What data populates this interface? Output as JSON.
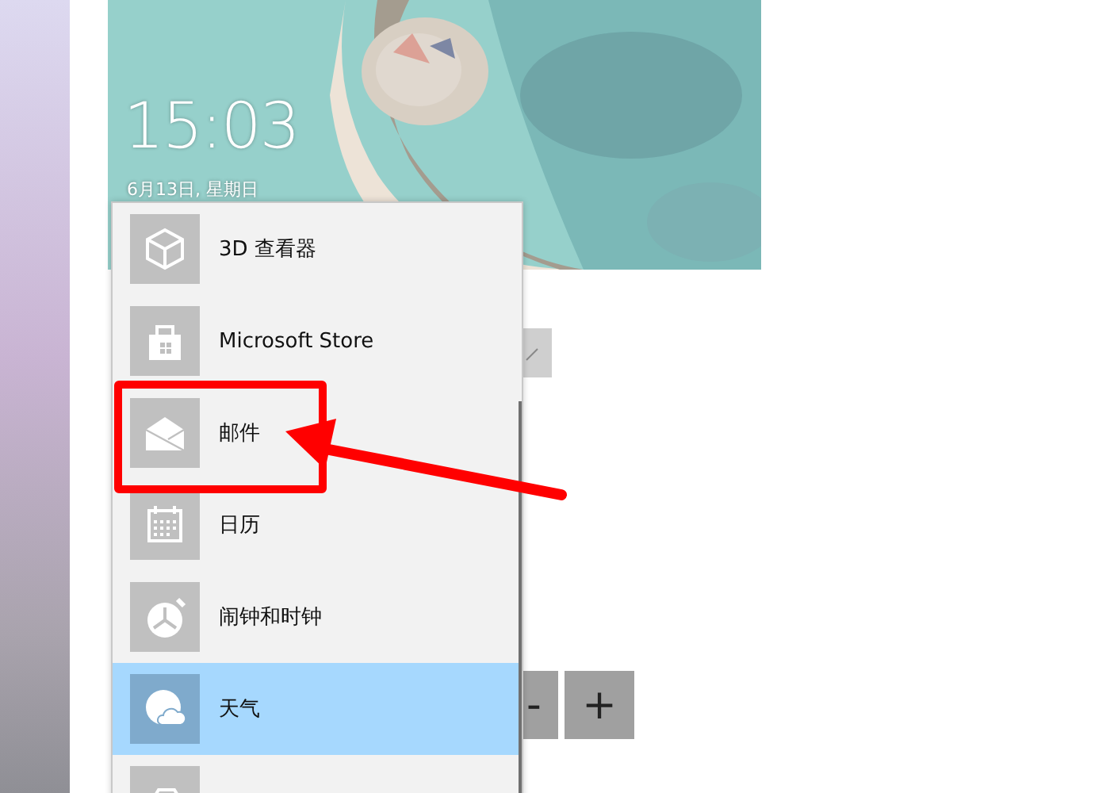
{
  "lock_preview": {
    "time": "15:03",
    "date": "6月13日, 星期日"
  },
  "size_buttons": [
    {
      "label": "-"
    },
    {
      "label": "+"
    }
  ],
  "app_menu": {
    "items": [
      {
        "kind": "cube",
        "label": "3D 查看器",
        "selected": false
      },
      {
        "kind": "store",
        "label": "Microsoft Store",
        "selected": false
      },
      {
        "kind": "mail",
        "label": "邮件",
        "selected": false
      },
      {
        "kind": "calendar",
        "label": "日历",
        "selected": false
      },
      {
        "kind": "clock",
        "label": "闹钟和时钟",
        "selected": false
      },
      {
        "kind": "weather",
        "label": "天气",
        "selected": true
      },
      {
        "kind": "other",
        "selected": false
      }
    ]
  }
}
